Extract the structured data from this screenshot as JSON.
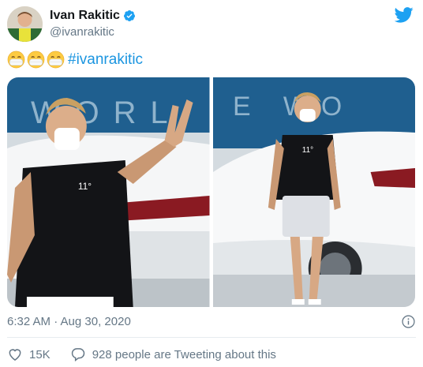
{
  "author": {
    "name": "Ivan Rakitic",
    "handle": "@ivanrakitic",
    "verified": true
  },
  "tweet": {
    "emojis": [
      "mask-face-emoji",
      "mask-face-emoji",
      "mask-face-emoji"
    ],
    "hashtag": "#ivanrakitic"
  },
  "media": {
    "images": [
      {
        "description_icon": "photo"
      },
      {
        "description_icon": "photo"
      }
    ]
  },
  "meta": {
    "timestamp": "6:32 AM · Aug 30, 2020"
  },
  "actions": {
    "likes": "15K",
    "conversation": "928 people are Tweeting about this"
  },
  "colors": {
    "link": "#1b95e0",
    "secondary_text": "#657786",
    "twitter_blue": "#1da1f2",
    "like_red": "#e0245e"
  }
}
